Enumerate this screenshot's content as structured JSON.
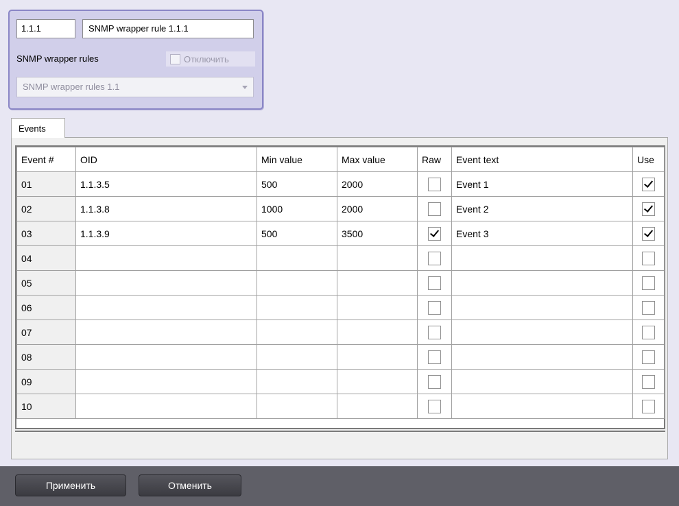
{
  "object": {
    "id": "1.1.1",
    "name": "SNMP wrapper rule 1.1.1",
    "parent_label": "SNMP wrapper rules",
    "disable_label": "Отключить",
    "disable_checked": false,
    "parent_value": "SNMP wrapper rules 1.1"
  },
  "tabs": [
    {
      "label": "Events",
      "active": true
    }
  ],
  "grid": {
    "columns": [
      "Event #",
      "OID",
      "Min value",
      "Max value",
      "Raw",
      "Event text",
      "Use"
    ],
    "rows": [
      {
        "num": "01",
        "oid": "1.1.3.5",
        "min": "500",
        "max": "2000",
        "raw": false,
        "text": "Event 1",
        "use": true
      },
      {
        "num": "02",
        "oid": "1.1.3.8",
        "min": "1000",
        "max": "2000",
        "raw": false,
        "text": "Event 2",
        "use": true
      },
      {
        "num": "03",
        "oid": "1.1.3.9",
        "min": "500",
        "max": "3500",
        "raw": true,
        "text": "Event 3",
        "use": true
      },
      {
        "num": "04",
        "oid": "",
        "min": "",
        "max": "",
        "raw": false,
        "text": "",
        "use": false
      },
      {
        "num": "05",
        "oid": "",
        "min": "",
        "max": "",
        "raw": false,
        "text": "",
        "use": false
      },
      {
        "num": "06",
        "oid": "",
        "min": "",
        "max": "",
        "raw": false,
        "text": "",
        "use": false
      },
      {
        "num": "07",
        "oid": "",
        "min": "",
        "max": "",
        "raw": false,
        "text": "",
        "use": false
      },
      {
        "num": "08",
        "oid": "",
        "min": "",
        "max": "",
        "raw": false,
        "text": "",
        "use": false
      },
      {
        "num": "09",
        "oid": "",
        "min": "",
        "max": "",
        "raw": false,
        "text": "",
        "use": false
      },
      {
        "num": "10",
        "oid": "",
        "min": "",
        "max": "",
        "raw": false,
        "text": "",
        "use": false
      }
    ]
  },
  "buttons": {
    "apply": "Применить",
    "cancel": "Отменить"
  }
}
